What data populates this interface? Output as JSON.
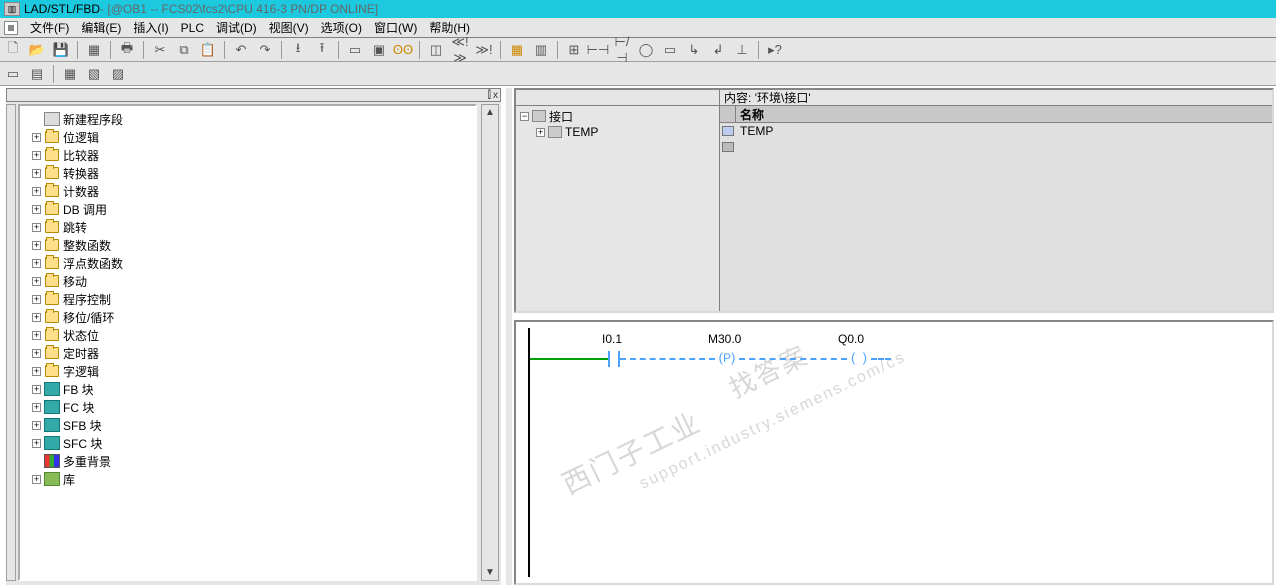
{
  "title": {
    "app": "LAD/STL/FBD",
    "doc": "  - [@OB1 -- FCS02\\fcs2\\CPU 416-3 PN/DP  ONLINE]"
  },
  "menu": {
    "file": "文件(F)",
    "edit": "编辑(E)",
    "insert": "插入(I)",
    "plc": "PLC",
    "debug": "调试(D)",
    "view": "视图(V)",
    "options": "选项(O)",
    "window": "窗口(W)",
    "help": "帮助(H)"
  },
  "tree": {
    "new_network": "新建程序段",
    "items": [
      "位逻辑",
      "比较器",
      "转换器",
      "计数器",
      "DB 调用",
      "跳转",
      "整数函数",
      "浮点数函数",
      "移动",
      "程序控制",
      "移位/循环",
      "状态位",
      "定时器",
      "字逻辑",
      "FB 块",
      "FC 块",
      "SFB 块",
      "SFC 块",
      "多重背景",
      "库"
    ]
  },
  "iface": {
    "content_label": "内容:",
    "content_path": "'环境\\接口'",
    "root": "接口",
    "temp": "TEMP",
    "col_name": "名称"
  },
  "ladder": {
    "in": "I0.1",
    "mem": "M30.0",
    "p": "P",
    "out": "Q0.0"
  },
  "watermark": {
    "a": "西门子工业",
    "b": "找答案",
    "c": "support.industry.siemens.com/cs"
  },
  "glyph": {
    "plus": "+",
    "minus": "−",
    "close": "x",
    "pin": "⫿",
    "up": "▲",
    "down": "▼"
  }
}
